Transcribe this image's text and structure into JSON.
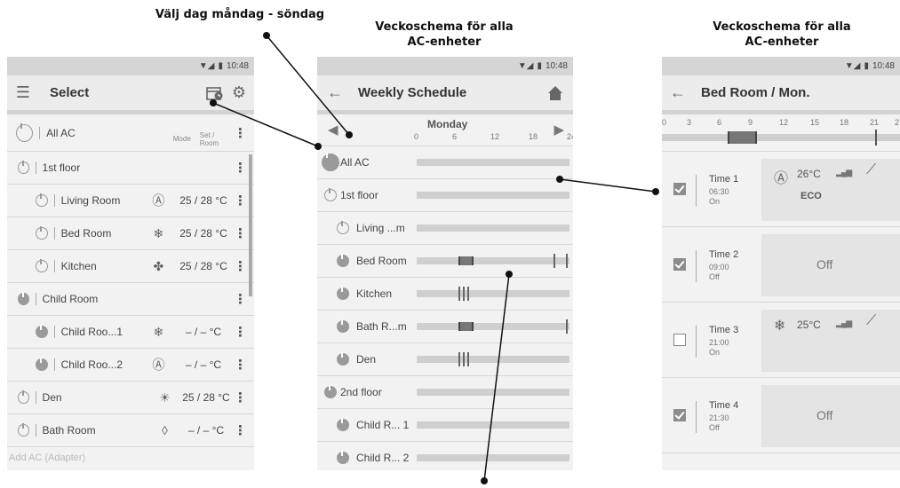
{
  "annotations": {
    "day_select": "Välj dag måndag - söndag",
    "weekly_all_1": "Veckoschema för alla",
    "weekly_all_2": "AC-enheter",
    "weekly_all_b1": "Veckoschema för alla",
    "weekly_all_b2": "AC-enheter"
  },
  "status": {
    "time": "10:48"
  },
  "select_screen": {
    "title": "Select",
    "col_mode": "Mode",
    "col_set_room": "Set / Room",
    "rows": [
      {
        "label": "All AC",
        "indent": 0,
        "power": "off",
        "mode": "",
        "value": "",
        "header": true
      },
      {
        "label": "1st floor",
        "indent": 0,
        "power": "off",
        "mode": "",
        "value": ""
      },
      {
        "label": "Living Room",
        "indent": 1,
        "power": "off",
        "mode": "Ⓐ",
        "value": "25 / 28 °C"
      },
      {
        "label": "Bed Room",
        "indent": 1,
        "power": "off",
        "mode": "❄",
        "value": "25 / 28 °C"
      },
      {
        "label": "Kitchen",
        "indent": 1,
        "power": "off",
        "mode": "✤",
        "value": "25 / 28 °C"
      },
      {
        "label": "Child Room",
        "indent": 0,
        "power": "on",
        "mode": "",
        "value": ""
      },
      {
        "label": "Child Roo...1",
        "indent": 1,
        "power": "on",
        "mode": "❄",
        "value": "– / –  °C"
      },
      {
        "label": "Child Roo...2",
        "indent": 1,
        "power": "on",
        "mode": "Ⓐ",
        "value": "– / –  °C"
      },
      {
        "label": "Den",
        "indent": 0,
        "power": "off",
        "mode": "☀",
        "value": "25 / 28 °C"
      },
      {
        "label": "Bath Room",
        "indent": 0,
        "power": "off",
        "mode": "◊",
        "value": "– / –  °C"
      }
    ],
    "footer": "Add AC (Adapter)"
  },
  "weekly_screen": {
    "title": "Weekly Schedule",
    "day": "Monday",
    "hours": [
      "0",
      "6",
      "12",
      "18",
      "24"
    ],
    "rows": [
      {
        "label": "All AC",
        "power": "on",
        "highlight": true,
        "segments": []
      },
      {
        "label": "1st floor",
        "power": "off",
        "segments": []
      },
      {
        "label": "Living ...m",
        "power": "off",
        "indent": true,
        "segments": []
      },
      {
        "label": "Bed Room",
        "power": "on",
        "indent": true,
        "segments": [
          {
            "start": 6.5,
            "end": 9
          },
          {
            "tick": 21.5
          },
          {
            "tick": 23.5
          }
        ]
      },
      {
        "label": "Kitchen",
        "power": "on",
        "indent": true,
        "segments": [
          {
            "tick": 6.5
          },
          {
            "tick": 7.2
          },
          {
            "tick": 7.9
          }
        ]
      },
      {
        "label": "Bath R...m",
        "power": "on",
        "indent": true,
        "segments": [
          {
            "start": 6.5,
            "end": 9
          },
          {
            "tick": 23.5
          }
        ]
      },
      {
        "label": "Den",
        "power": "on",
        "indent": true,
        "segments": [
          {
            "tick": 6.5
          },
          {
            "tick": 7.2
          },
          {
            "tick": 7.9
          }
        ]
      },
      {
        "label": "2nd floor",
        "power": "on",
        "segments": []
      },
      {
        "label": "Child R... 1",
        "power": "on",
        "indent": true,
        "segments": []
      },
      {
        "label": "Child R... 2",
        "power": "on",
        "indent": true,
        "segments": []
      }
    ]
  },
  "detail_screen": {
    "title": "Bed Room / Mon.",
    "hours": [
      "0",
      "3",
      "6",
      "9",
      "12",
      "15",
      "18",
      "21",
      "2"
    ],
    "times": [
      {
        "label": "Time 1",
        "time": "06:30",
        "state": "On",
        "checked": true,
        "temp": "26°C",
        "mode": "Ⓐ",
        "extra": "ECO",
        "off_text": ""
      },
      {
        "label": "Time 2",
        "time": "09:00",
        "state": "Off",
        "checked": true,
        "temp": "",
        "mode": "",
        "extra": "",
        "off_text": "Off"
      },
      {
        "label": "Time 3",
        "time": "21:00",
        "state": "On",
        "checked": false,
        "temp": "25°C",
        "mode": "❄",
        "extra": "",
        "off_text": ""
      },
      {
        "label": "Time 4",
        "time": "21:30",
        "state": "Off",
        "checked": true,
        "temp": "",
        "mode": "",
        "extra": "",
        "off_text": "Off"
      }
    ]
  }
}
